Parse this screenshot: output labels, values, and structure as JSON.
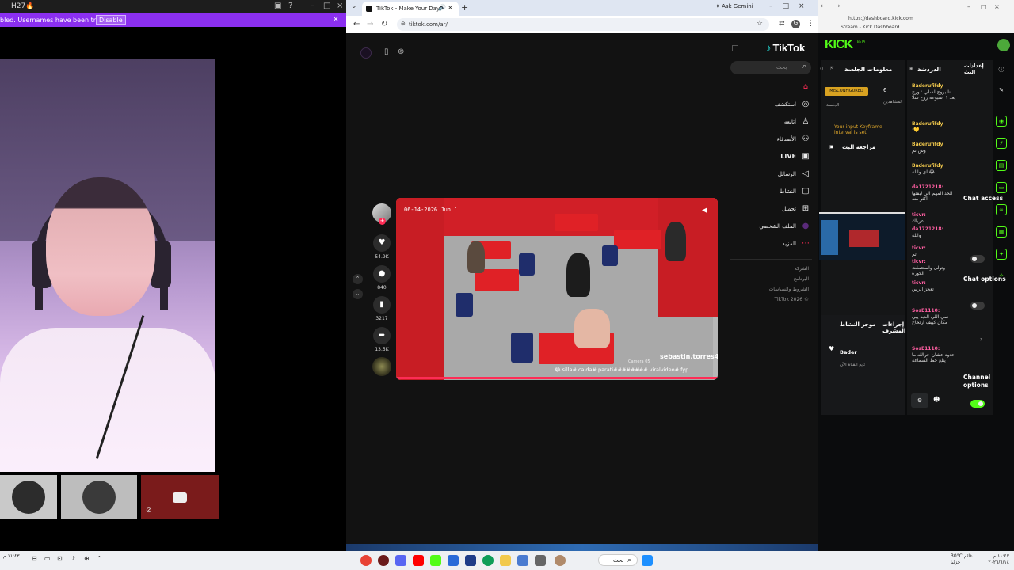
{
  "left_window": {
    "title": "H27🔥",
    "banner_text": "bled. Usernames have been truncated.",
    "banner_button": "Disable",
    "close": "×"
  },
  "browser": {
    "tab_title": "TikTok - Make Your Day",
    "new_tab": "+",
    "gemini_label": "Ask Gemini",
    "url": "tiktok.com/ar/"
  },
  "tiktok": {
    "logo": "TikTok",
    "search_placeholder": "بحث",
    "nav": [
      {
        "label": "",
        "icon": "home-icon",
        "glyph": "⌂"
      },
      {
        "label": "استكشف",
        "icon": "compass-icon",
        "glyph": "◎"
      },
      {
        "label": "أتابعه",
        "icon": "following-icon",
        "glyph": "♙"
      },
      {
        "label": "الأصدقاء",
        "icon": "friends-icon",
        "glyph": "⚇"
      },
      {
        "label": "LIVE",
        "icon": "live-icon",
        "glyph": "▣"
      },
      {
        "label": "الرسائل",
        "icon": "messages-icon",
        "glyph": "◁"
      },
      {
        "label": "النشاط",
        "icon": "activity-icon",
        "glyph": "▢"
      },
      {
        "label": "تحميل",
        "icon": "upload-icon",
        "glyph": "⊞"
      },
      {
        "label": "الملف الشخصي",
        "icon": "profile-icon",
        "glyph": "●"
      },
      {
        "label": "المزيد",
        "icon": "more-icon",
        "glyph": "⋯"
      }
    ],
    "footer": [
      "الشركة",
      "البرنامج",
      "الشروط والسياسات",
      "TikTok 2026 ©"
    ],
    "video": {
      "date_overlay": "06-14-2026 Jun 1",
      "username": "sebastin.torres4",
      "caption": "😂 silla# caida# parati######## viralvideo# fyp...",
      "camera_label": "Camera 05"
    },
    "actions": {
      "likes": "54.9K",
      "comments": "840",
      "saves": "3217",
      "shares": "13.5K"
    }
  },
  "kick": {
    "window_url": "https://dashboard.kick.com",
    "window_title": "Stream - Kick Dashboard",
    "logo": "KICK",
    "beta": "BETA",
    "session_title": "معلومات الجلسة",
    "chat_title": "الدردشة",
    "live_title": "إعدادات البث",
    "warning_badge": "MISCONFIGURED",
    "viewers_count": "6",
    "viewers_label": "المشاهدين",
    "session_label": "الجلسة",
    "keyframe_note": "Your input Keyframe interval is set",
    "review_label": "مراجعة البث",
    "chat_messages": [
      {
        "user": "Baderufifdy",
        "text": "انا بروح لسلي : ورح يعد ١ اسبوعه روح سلا",
        "color": "#f2c94c"
      },
      {
        "user": "Baderufifdy",
        "text": ":💛",
        "color": "#f2c94c"
      },
      {
        "user": "Baderufifdy",
        "text": "وش نم",
        "color": "#f2c94c"
      },
      {
        "user": "Baderufifdy",
        "text": "اي واللة 😂",
        "color": "#f2c94c"
      },
      {
        "user": "da1721218:",
        "text": "الحد المهم الي لبقتها أكثر منه",
        "color": "#ff5fa2"
      },
      {
        "user": "ticvr:",
        "text": "عرباك",
        "color": "#ff5fa2"
      },
      {
        "user": "da1721218:",
        "text": "والله",
        "color": "#ff5fa2"
      },
      {
        "user": "ticvr:",
        "text": "تم",
        "color": "#ff5fa2"
      },
      {
        "user": "ticvr:",
        "text": "وتولى واستعملت الكوره",
        "color": "#ff5fa2"
      },
      {
        "user": "ticvr:",
        "text": "تعجز الرس",
        "color": "#ff5fa2"
      },
      {
        "user": "SosE1110:",
        "text": "سي اللي الدبه يبي مكان كيبف ارتحاح",
        "color": "#ff5fa2"
      },
      {
        "user": "SosE1110:",
        "text": "حدود عشان جرالله ما ينلع حط السماعة",
        "color": "#ff5fa2"
      }
    ],
    "chat_access": "Chat access",
    "chat_options": "Chat options",
    "channel_options": "Channel options",
    "mod_actions": "إجراءات المشرف",
    "moderators": "موجز النشاط",
    "activity_user": "Bader",
    "activity_text": "تابع القناة الآن",
    "colors": {
      "accent": "#53fc18",
      "warning": "#d8a221",
      "tiktok_red": "#fe2c55"
    }
  },
  "taskbar": {
    "search": "بحث",
    "weather": "30°C غائم جزئيا",
    "time": "١١:٤٣ م",
    "date": "٢٠٢٦/٦/١٤",
    "left_time": "١١:٤٣ م"
  }
}
